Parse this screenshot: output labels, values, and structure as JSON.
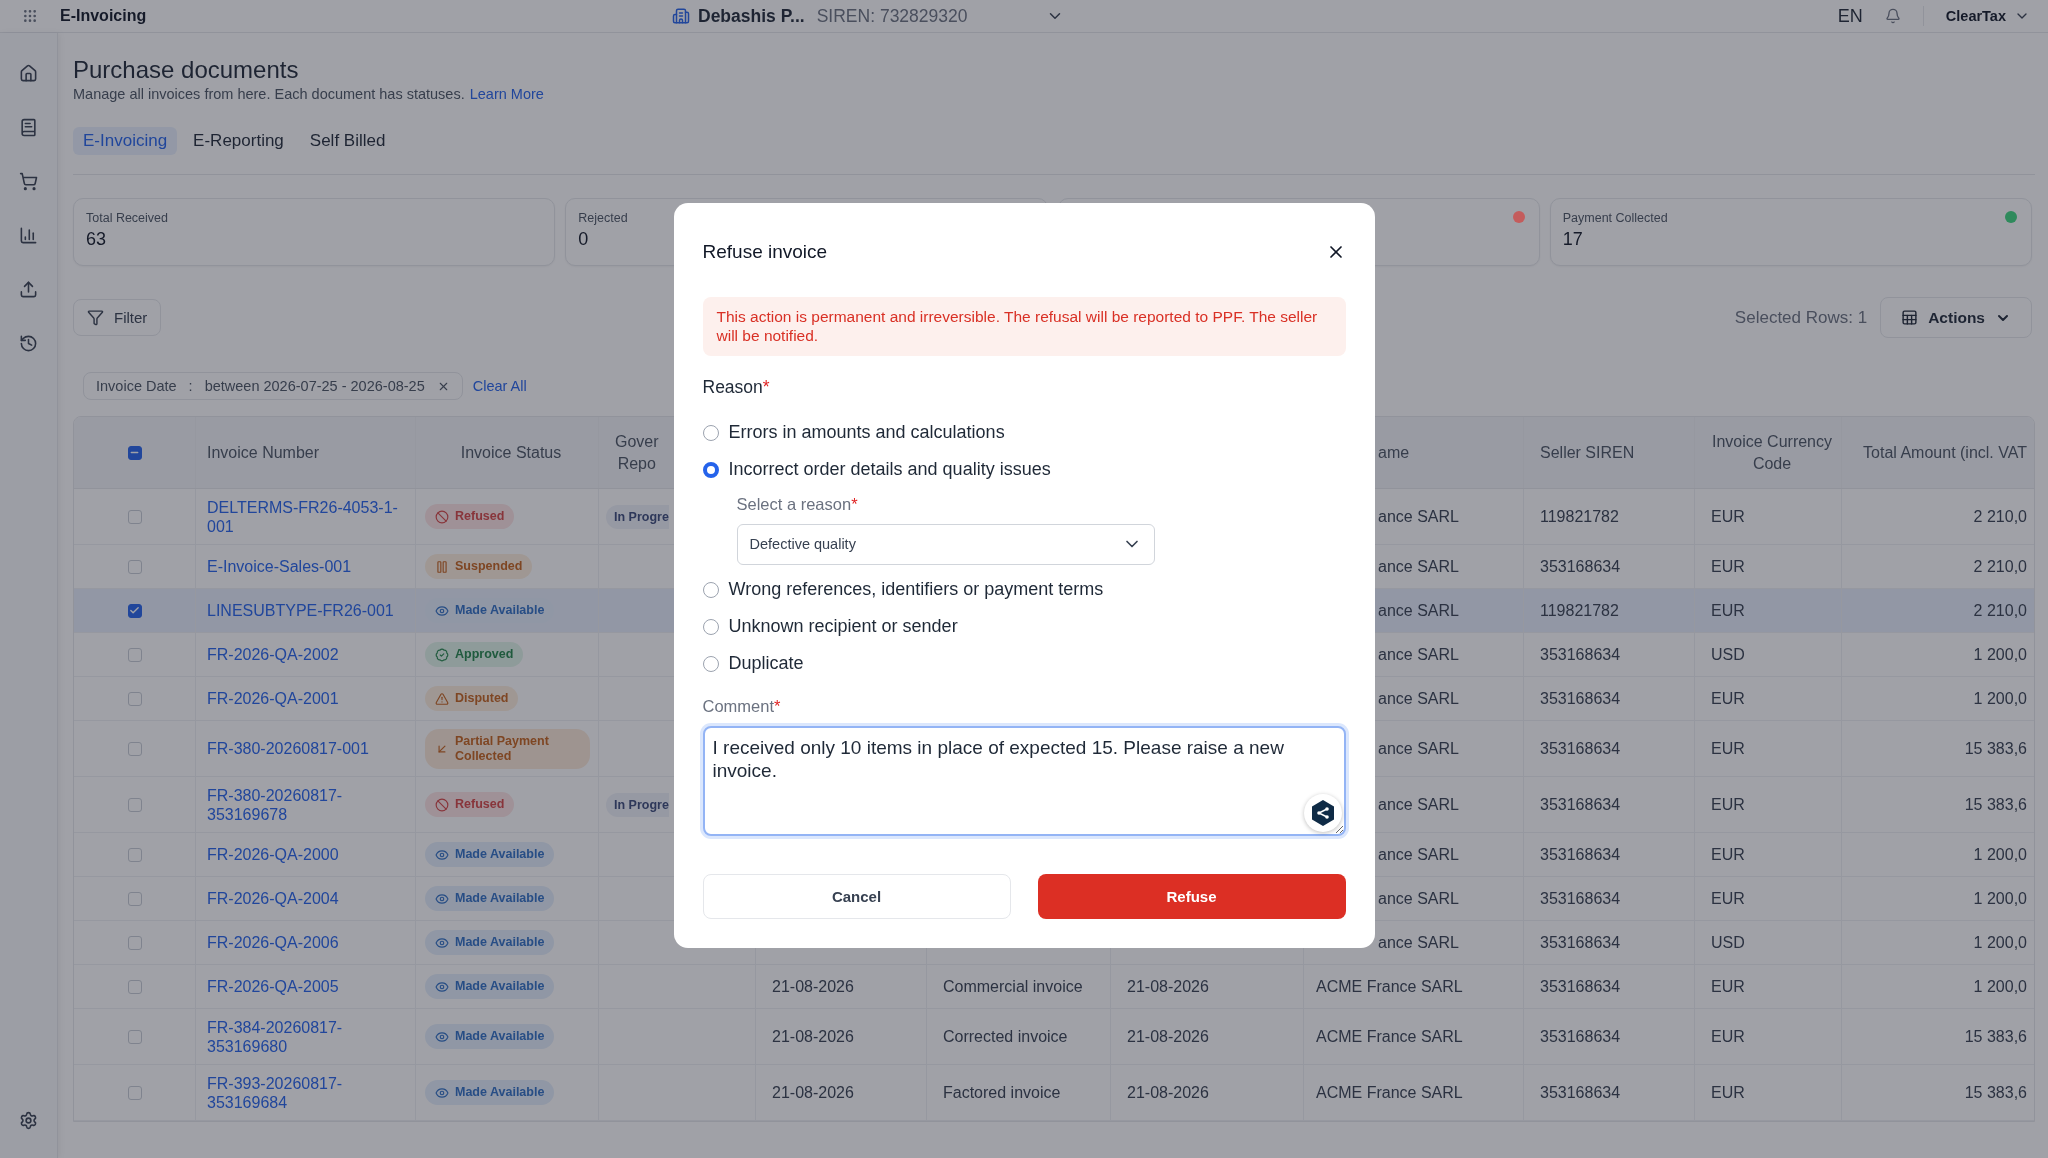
{
  "top_bar": {
    "app_name": "E-Invoicing",
    "entity": "Debashis P...",
    "siren": "SIREN: 732829320",
    "language": "EN",
    "account": "ClearTax"
  },
  "page": {
    "title": "Purchase documents",
    "subtitle": "Manage all invoices from here. Each document has statuses.",
    "link": "Learn More"
  },
  "tabs": [
    {
      "label": "E-Invoicing",
      "selected": true
    },
    {
      "label": "E-Reporting",
      "selected": false
    },
    {
      "label": "Self Billed",
      "selected": false
    }
  ],
  "stat_cards": [
    {
      "label": "Total Received",
      "value": "63"
    },
    {
      "label": "Rejected",
      "value": "0"
    },
    {
      "color": "#c45c5c"
    },
    {
      "label": "Payment Collected",
      "value": "17",
      "color": "#2f8a5c"
    }
  ],
  "toolbar": {
    "filter": "Filter",
    "selected_rows": "Selected Rows: 1",
    "actions": "Actions"
  },
  "filters": {
    "chips": [
      {
        "field": "Invoice Date",
        "separator": ":",
        "value": "between 2026-07-25 - 2026-08-25"
      }
    ],
    "clear": "Clear All"
  },
  "table": {
    "header_checkbox": {
      "partial": true
    },
    "header": {
      "invoice_number": "Invoice Number",
      "invoice_status": "Invoice Status",
      "column_4": [
        "Gover",
        "Repo"
      ],
      "column_8": "ame",
      "seller_siren": "Seller SIREN",
      "currency": "Invoice Currency Code",
      "total": "Total Amount (incl. VAT"
    },
    "rows": [
      {
        "selected": false,
        "covered": true,
        "number": "DELTERMS-FR26-4053-1-001",
        "status": {
          "kind": "refused",
          "label": "Refused"
        },
        "column_4": "In Progre",
        "column_8": "ance SARL",
        "seller_siren": "119821782",
        "currency": "EUR",
        "total": "2 210,0"
      },
      {
        "selected": false,
        "covered": true,
        "number": "E-Invoice-Sales-001",
        "status": {
          "kind": "suspended",
          "label": "Suspended"
        },
        "column_8": "ance SARL",
        "seller_siren": "353168634",
        "currency": "EUR",
        "total": "2 210,0"
      },
      {
        "selected": true,
        "covered": true,
        "number": "LINESUBTYPE-FR26-001",
        "status": {
          "kind": "available",
          "label": "Made Available"
        },
        "column_8": "ance SARL",
        "seller_siren": "119821782",
        "currency": "EUR",
        "total": "2 210,0"
      },
      {
        "selected": false,
        "covered": true,
        "number": "FR-2026-QA-2002",
        "status": {
          "kind": "approved",
          "label": "Approved"
        },
        "column_8": "ance SARL",
        "seller_siren": "353168634",
        "currency": "USD",
        "total": "1 200,0"
      },
      {
        "selected": false,
        "covered": true,
        "number": "FR-2026-QA-2001",
        "status": {
          "kind": "disputed",
          "label": "Disputed"
        },
        "column_8": "ance SARL",
        "seller_siren": "353168634",
        "currency": "EUR",
        "total": "1 200,0"
      },
      {
        "selected": false,
        "covered": true,
        "number": "FR-380-20260817-001",
        "status": {
          "kind": "partial",
          "label": "Partial Payment Collected"
        },
        "column_8": "ance SARL",
        "seller_siren": "353168634",
        "currency": "EUR",
        "total": "15 383,6"
      },
      {
        "selected": false,
        "covered": true,
        "number": "FR-380-20260817-353169678",
        "status": {
          "kind": "refused",
          "label": "Refused"
        },
        "column_4": "In Progre",
        "column_8": "ance SARL",
        "seller_siren": "353168634",
        "currency": "EUR",
        "total": "15 383,6"
      },
      {
        "selected": false,
        "covered": true,
        "number": "FR-2026-QA-2000",
        "status": {
          "kind": "available",
          "label": "Made Available"
        },
        "column_8": "ance SARL",
        "seller_siren": "353168634",
        "currency": "EUR",
        "total": "1 200,0"
      },
      {
        "selected": false,
        "covered": true,
        "number": "FR-2026-QA-2004",
        "status": {
          "kind": "available",
          "label": "Made Available"
        },
        "column_8": "ance SARL",
        "seller_siren": "353168634",
        "currency": "EUR",
        "total": "1 200,0"
      },
      {
        "selected": false,
        "covered": true,
        "number": "FR-2026-QA-2006",
        "status": {
          "kind": "available",
          "label": "Made Available"
        },
        "column_8": "ance SARL",
        "seller_siren": "353168634",
        "currency": "USD",
        "total": "1 200,0"
      },
      {
        "selected": false,
        "covered": false,
        "number": "FR-2026-QA-2005",
        "status": {
          "kind": "available",
          "label": "Made Available"
        },
        "column_5": "21-08-2026",
        "column_6": "Commercial invoice",
        "column_7": "21-08-2026",
        "column_8": "ACME France SARL",
        "seller_siren": "353168634",
        "currency": "EUR",
        "total": "1 200,0"
      },
      {
        "selected": false,
        "covered": false,
        "number": "FR-384-20260817-353169680",
        "status": {
          "kind": "available",
          "label": "Made Available"
        },
        "column_5": "21-08-2026",
        "column_6": "Corrected invoice",
        "column_7": "21-08-2026",
        "column_8": "ACME France SARL",
        "seller_siren": "353168634",
        "currency": "EUR",
        "total": "15 383,6"
      },
      {
        "selected": false,
        "covered": false,
        "number": "FR-393-20260817-353169684",
        "status": {
          "kind": "available",
          "label": "Made Available"
        },
        "column_5": "21-08-2026",
        "column_6": "Factored invoice",
        "column_7": "21-08-2026",
        "column_8": "ACME France SARL",
        "seller_siren": "353168634",
        "currency": "EUR",
        "total": "15 383,6"
      }
    ]
  },
  "refuse_dialog": {
    "title": "Refuse invoice",
    "warning": "This action is permanent and irreversible. The refusal will be reported to PPF. The seller will be notified.",
    "reason_label": {
      "text": "Reason",
      "mark": "*"
    },
    "reasons": [
      {
        "label": "Errors in amounts and calculations",
        "selected": false
      },
      {
        "label": "Incorrect order details and quality issues",
        "selected": true,
        "sub_select": {
          "label": {
            "text": "Select a reason",
            "mark": "*"
          },
          "value": "Defective quality"
        }
      },
      {
        "label": "Wrong references, identifiers or payment terms",
        "selected": false
      },
      {
        "label": "Unknown recipient or sender",
        "selected": false
      },
      {
        "label": "Duplicate",
        "selected": false
      }
    ],
    "comment_label": {
      "text": "Comment",
      "mark": "*"
    },
    "comment": "I received only 10 items in place of expected 15. Please raise a new invoice.",
    "buttons": {
      "cancel": "Cancel",
      "refuse": "Refuse"
    }
  }
}
